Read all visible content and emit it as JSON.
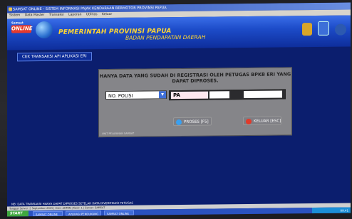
{
  "window": {
    "title": "SAMSAT ONLINE - SISTEM INFORMASI PAJAK KENDARAAN BERMOTOR PROVINSI PAPUA"
  },
  "menubar": [
    "Sistem",
    "Data Master",
    "Transaksi",
    "Laporan",
    "Utilitas",
    "Keluar"
  ],
  "banner": {
    "logo_top": "Samsat",
    "logo_main": "ONLINE",
    "title": "PEMERINTAH PROVINSI PAPUA",
    "subtitle": "BADAN PENDAPATAN DAERAH"
  },
  "tab": {
    "label": "CEK TRANSAKSI API APLIKASI ERI"
  },
  "dialog": {
    "message": "HANYA DATA YANG SUDAH DI REGISTRASI OLEH PETUGAS BPKB ERI YANG DAPAT DIPROSES.",
    "select_value": "NO. POLISI",
    "plate_prefix": "PA",
    "proses_label": "PROSES [F5]",
    "keluar_label": "KELUAR [ESC]",
    "footer": "UNIT PELAYANAN SAMSAT"
  },
  "status": {
    "message": "NB: DATA TRANSAKSI HANYA DAPAT DIPROSES SETELAH DATA DIVERIFIKASI PETUGAS",
    "info": "Tanggal Server: 2 September 2023 | User: ADMIN | Kasir: 1 | Server: SAMSAT"
  },
  "taskbar": {
    "start": "START",
    "tasks": [
      "SAMSAT ONLINE",
      "APLIKASI PENDUKUNG",
      "SAMSAT ONLINE"
    ],
    "tray": "09.41"
  }
}
